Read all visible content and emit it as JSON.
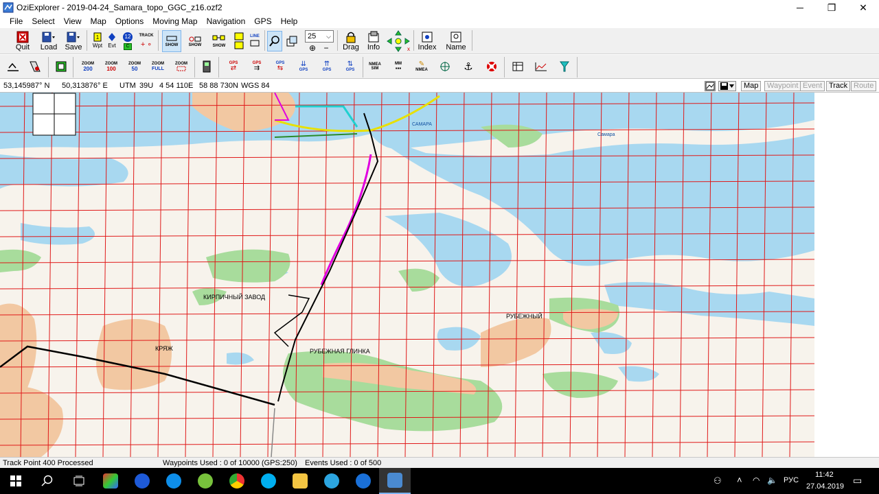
{
  "window": {
    "title": "OziExplorer - 2019-04-24_Samara_topo_GGC_z16.ozf2",
    "minimize": "─",
    "maximize": "❐",
    "close": "✕"
  },
  "menu": [
    "File",
    "Select",
    "View",
    "Map",
    "Options",
    "Moving Map",
    "Navigation",
    "GPS",
    "Help"
  ],
  "toolbar": {
    "quit": "Quit",
    "load": "Load",
    "save": "Save",
    "wpt": "Wpt",
    "evt": "Evt",
    "track": "TRACK",
    "track_num": "12",
    "show": "SHOW",
    "line": "LINE",
    "zoom_value": "25",
    "drag": "Drag",
    "info": "Info",
    "index": "Index",
    "name": "Name"
  },
  "toolbar2": {
    "zoom200": [
      "ZOOM",
      "200"
    ],
    "zoom100": [
      "ZOOM",
      "100"
    ],
    "zoom50": [
      "ZOOM",
      "50"
    ],
    "zoomfull": [
      "ZOOM",
      "FULL"
    ],
    "zoomsel": "ZOOM",
    "gps": "GPS",
    "nmea_sim": [
      "NMEA",
      "SIM"
    ],
    "mm": "MM",
    "nmea": "NMEA"
  },
  "coords": {
    "lat": "53,145987° N",
    "lon": "50,313876° E",
    "utm_label": "UTM",
    "zone": "39U",
    "easting": "4 54 110E",
    "northing": "58 88 730N",
    "datum": "WGS 84"
  },
  "tabs": [
    {
      "label": "Map",
      "enabled": true
    },
    {
      "label": "Waypoint",
      "enabled": false
    },
    {
      "label": "Event",
      "enabled": false
    },
    {
      "label": "Track",
      "enabled": true
    },
    {
      "label": "Route",
      "enabled": false
    }
  ],
  "map_labels": {
    "kirpichny": "КИРПИЧНЫЙ ЗАВОД",
    "kryazh": "КРЯЖ",
    "rubezhny": "РУБЕЖНЫЙ",
    "rubezhnaya": "РУБЕЖНАЯ ГЛИНКА",
    "samara1": "САМАРА",
    "samara2": "Самара"
  },
  "status": {
    "track": "Track Point 400 Processed",
    "waypoints": "Waypoints Used : 0 of 10000  (GPS:250)",
    "events": "Events Used : 0 of 500"
  },
  "tray": {
    "lang": "РУС",
    "time": "11:42",
    "date": "27.04.2019"
  },
  "colors": {
    "water": "#a8d8f0",
    "land": "#f7f3ec",
    "forest": "#a8dc9c",
    "urban": "#f2c8a2",
    "grid": "#e01818",
    "track": "#000000",
    "route_magenta": "#e000e0"
  }
}
